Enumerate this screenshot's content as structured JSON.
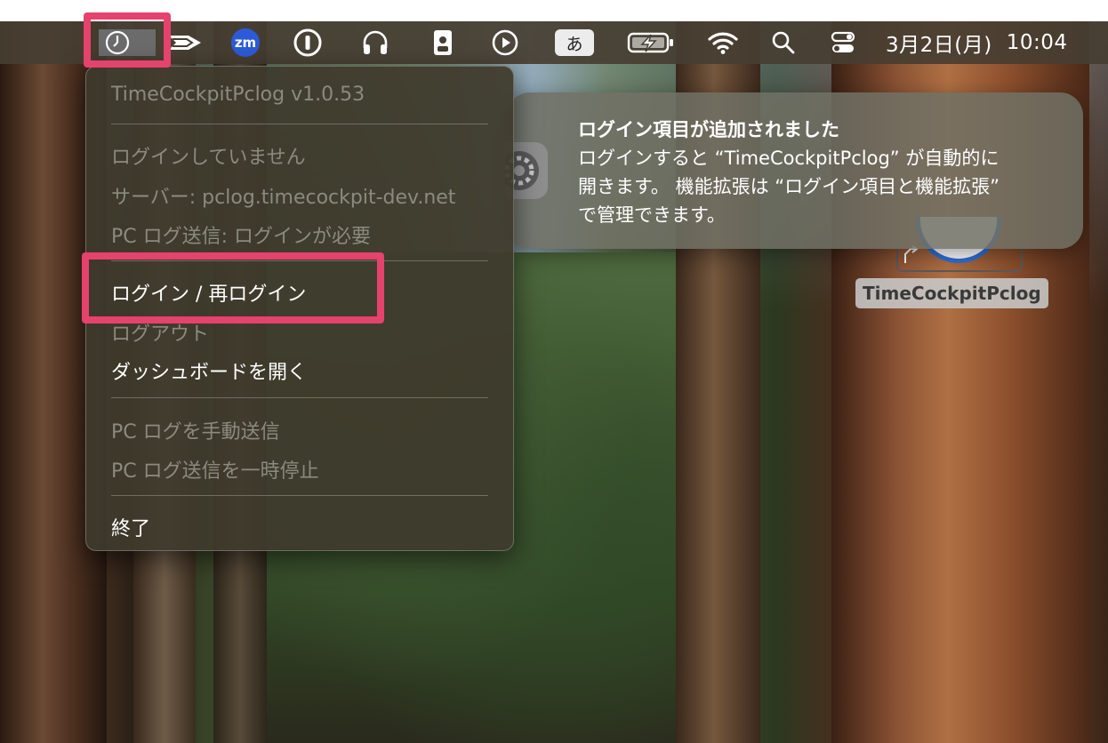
{
  "menubar": {
    "ime_label": "あ",
    "zoom_label": "zm",
    "clock_date": "3月2日(月)",
    "clock_time": "10:04",
    "icons": [
      "timecockpit-clock-icon",
      "pace-arrow-icon",
      "zoom-icon",
      "onepassword-icon",
      "headphones-icon",
      "badge-icon",
      "play-icon",
      "input-method-icon",
      "battery-charging-icon",
      "wifi-icon",
      "search-icon",
      "control-center-icon"
    ]
  },
  "menu": {
    "app_version": "TimeCockpitPclog v1.0.53",
    "status_login": "ログインしていません",
    "status_server": "サーバー: pclog.timecockpit-dev.net",
    "status_pclog": "PC ログ送信: ログインが必要",
    "login": "ログイン / 再ログイン",
    "logout": "ログアウト",
    "dashboard": "ダッシュボードを開く",
    "send_manual": "PC ログを手動送信",
    "pause_send": "PC ログ送信を一時停止",
    "quit": "終了"
  },
  "notification": {
    "title": "ログイン項目が追加されました",
    "line1": "ログインすると “TimeCockpitPclog” が自動的に",
    "line2": "開きます。 機能拡張は “ログイン項目と機能拡張”",
    "line3": "で管理できます。",
    "icon": "system-settings-gear-icon"
  },
  "desktop": {
    "icon_label": "TimeCockpitPclog"
  },
  "colors": {
    "highlight": "#e5426e",
    "menubar": "#463e32",
    "menu_bg": "#3e3a2c"
  }
}
